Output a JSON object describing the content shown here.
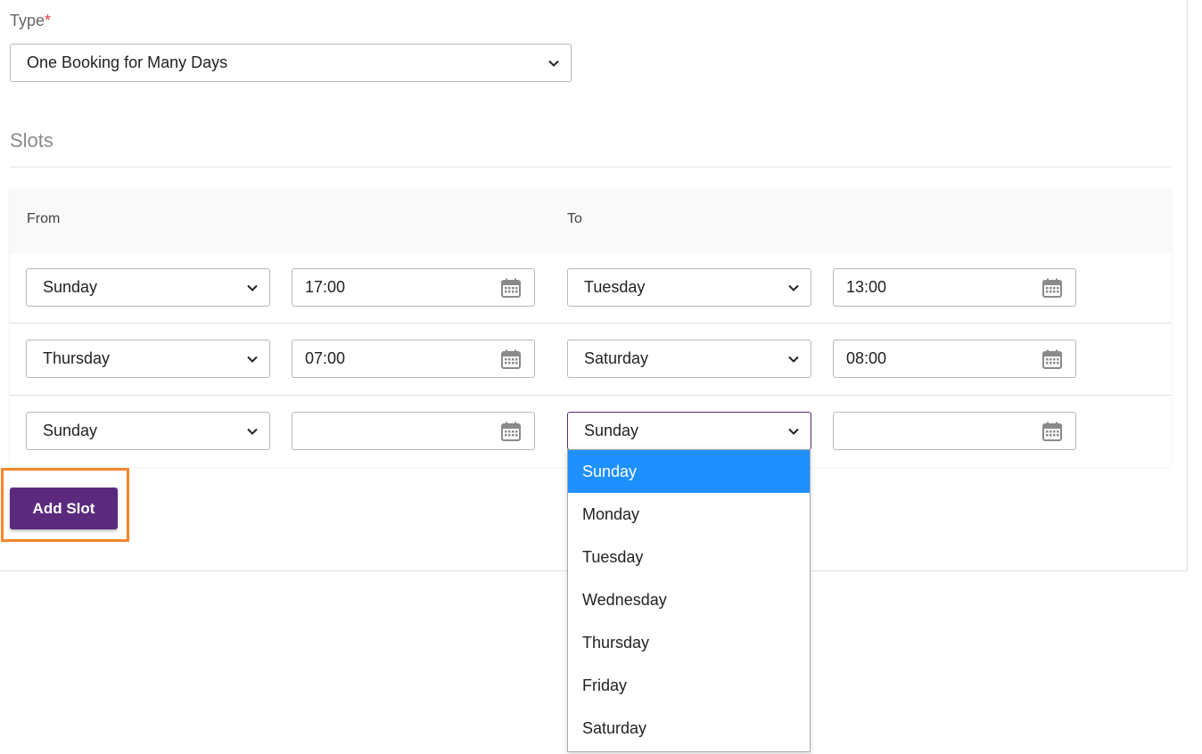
{
  "form": {
    "type_label": "Type",
    "required_mark": "*",
    "type_value": "One Booking for Many Days"
  },
  "slots": {
    "title": "Slots",
    "header_from": "From",
    "header_to": "To",
    "rows": [
      {
        "from_day": "Sunday",
        "from_time": "17:00",
        "to_day": "Tuesday",
        "to_time": "13:00"
      },
      {
        "from_day": "Thursday",
        "from_time": "07:00",
        "to_day": "Saturday",
        "to_time": "08:00"
      },
      {
        "from_day": "Sunday",
        "from_time": "",
        "to_day": "Sunday",
        "to_time": ""
      }
    ],
    "add_button": "Add Slot"
  },
  "day_dropdown": {
    "selected": "Sunday",
    "options": [
      "Sunday",
      "Monday",
      "Tuesday",
      "Wednesday",
      "Thursday",
      "Friday",
      "Saturday"
    ]
  },
  "colors": {
    "accent_purple": "#5b2a7e",
    "highlight_orange": "#f5862a",
    "option_selected_blue": "#1e90ff",
    "required_red": "#e03a3a"
  },
  "icons": {
    "select_arrow": "chevron-down-icon",
    "time_picker": "calendar-icon"
  }
}
